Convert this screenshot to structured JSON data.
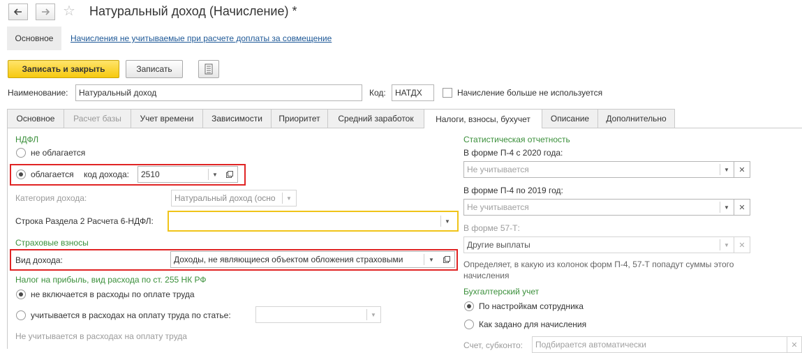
{
  "window": {
    "title": "Натуральный доход (Начисление) *",
    "nav_back_icon": "arrow-left-icon",
    "nav_forward_icon": "arrow-right-icon",
    "favorite_icon": "star-icon"
  },
  "topnav": {
    "main_label": "Основное",
    "link_label": "Начисления не учитываемые при расчете доплаты за совмещение"
  },
  "toolbar": {
    "save_close_label": "Записать и закрыть",
    "save_label": "Записать",
    "report_icon": "document-list-icon"
  },
  "header": {
    "name_label": "Наименование:",
    "name_value": "Натуральный доход",
    "code_label": "Код:",
    "code_value": "НАТДХ",
    "unused_label": "Начисление больше не используется"
  },
  "tabs": [
    {
      "label": "Основное"
    },
    {
      "label": "Расчет базы"
    },
    {
      "label": "Учет времени"
    },
    {
      "label": "Зависимости"
    },
    {
      "label": "Приоритет"
    },
    {
      "label": "Средний заработок"
    },
    {
      "label": "Налоги, взносы, бухучет"
    },
    {
      "label": "Описание"
    },
    {
      "label": "Дополнительно"
    }
  ],
  "left": {
    "ndfl_header": "НДФЛ",
    "not_taxed_label": "не облагается",
    "taxed_label": "облагается",
    "income_code_label": "код дохода:",
    "income_code_value": "2510",
    "income_category_label": "Категория дохода:",
    "income_category_value": "Натуральный доход (осно",
    "row_6ndfl_label": "Строка Раздела 2 Расчета 6-НДФЛ:",
    "row_6ndfl_value": "",
    "insurance_header": "Страховые взносы",
    "income_type_label": "Вид дохода:",
    "income_type_value": "Доходы, не являющиеся объектом обложения страховыми",
    "profit_tax_header": "Налог на прибыль, вид расхода по ст. 255 НК РФ",
    "not_included_label": "не включается в расходы по оплате труда",
    "included_label": "учитывается в расходах на оплату труда по статье:",
    "not_counted_label": "Не учитывается в расходах на оплату труда"
  },
  "right": {
    "stat_header": "Статистическая отчетность",
    "p4_2020_label": "В форме П-4 с 2020 года:",
    "p4_2020_placeholder": "Не учитывается",
    "p4_2019_label": "В форме П-4 по 2019 год:",
    "p4_2019_placeholder": "Не учитывается",
    "form57_label": "В форме 57-Т:",
    "form57_value": "Другие выплаты",
    "note": "Определяет, в какую из колонок форм П-4, 57-Т попадут суммы этого начисления",
    "accounting_header": "Бухгалтерский учет",
    "by_employee_label": "По настройкам сотрудника",
    "as_set_label": "Как задано для начисления",
    "account_label": "Счет, субконто:",
    "account_placeholder": "Подбирается автоматически"
  },
  "colors": {
    "accent_yellow": "#f6c90f",
    "group_header_green": "#3a8f3a",
    "link_blue": "#1c5796",
    "highlight_red": "#e02424",
    "focus_yellow": "#f0c419"
  }
}
